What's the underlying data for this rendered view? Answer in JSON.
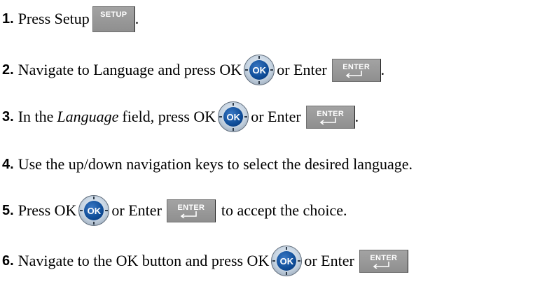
{
  "steps": [
    {
      "num": "1.",
      "parts": [
        "Press Setup",
        "."
      ],
      "key": "SETUP"
    },
    {
      "num": "2.",
      "parts": [
        "Navigate to Language and press OK",
        "or Enter",
        "."
      ],
      "key": "ENTER"
    },
    {
      "num": "3.",
      "parts": [
        "In the",
        "Language",
        "field, press OK",
        "or Enter",
        "."
      ],
      "key": "ENTER"
    },
    {
      "num": "4.",
      "parts": [
        "Use the up/down navigation keys to select the desired language."
      ]
    },
    {
      "num": "5.",
      "parts": [
        "Press OK",
        "or Enter",
        "to accept the choice."
      ],
      "key": "ENTER"
    },
    {
      "num": "6.",
      "parts": [
        "Navigate to the OK button and press OK",
        "or Enter"
      ],
      "key": "ENTER"
    }
  ],
  "ok_label": "OK",
  "icons": {
    "ok": "ok-button-icon",
    "enter": "enter-key-icon",
    "setup": "setup-key-icon",
    "return_arrow": "return-arrow-icon"
  },
  "colors": {
    "ok_blue": "#0f4d98",
    "key_gray": "#999999",
    "text": "#000000"
  }
}
